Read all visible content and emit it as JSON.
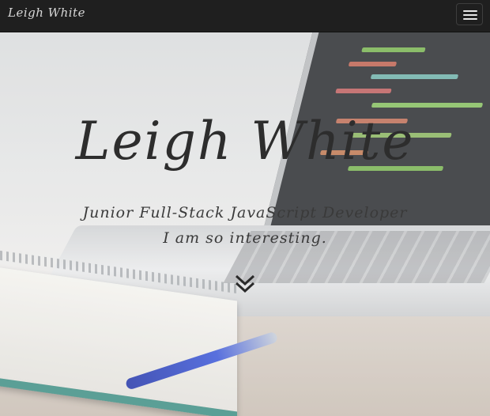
{
  "navbar": {
    "brand": "Leigh White",
    "menu_icon": "hamburger-menu-icon"
  },
  "hero": {
    "title": "Leigh White",
    "subtitle": "Junior Full-Stack JavaScript Developer",
    "tagline": "I am so interesting.",
    "scroll_icon": "double-chevron-down-icon"
  },
  "colors": {
    "navbar_bg": "#1f1f1f",
    "brand_text": "#d8d8d8",
    "hero_text": "#2d2d2d"
  }
}
